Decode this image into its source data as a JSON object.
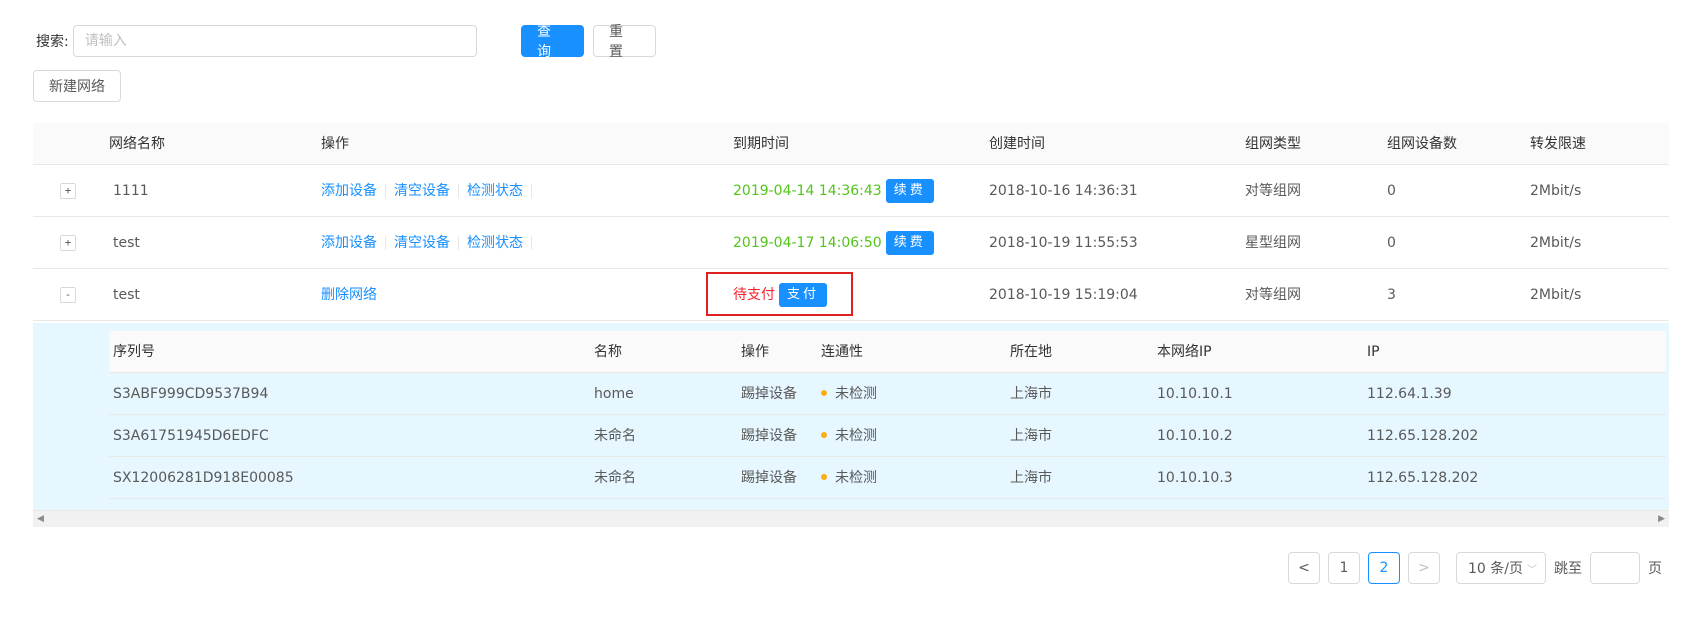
{
  "search": {
    "label": "搜索:",
    "placeholder": "请输入",
    "query_label": "查询",
    "reset_label": "重置"
  },
  "toolbar": {
    "new_network_label": "新建网络"
  },
  "table": {
    "headers": {
      "name": "网络名称",
      "ops": "操作",
      "expire": "到期时间",
      "created": "创建时间",
      "type": "组网类型",
      "device_count": "组网设备数",
      "rate": "转发限速"
    },
    "rows": [
      {
        "expand": "+",
        "name": "1111",
        "ops": [
          "添加设备",
          "清空设备",
          "检测状态"
        ],
        "expire": "2019-04-14 14:36:43",
        "expire_action": "续费",
        "created": "2018-10-16 14:36:31",
        "type": "对等组网",
        "device_count": "0",
        "rate": "2Mbit/s"
      },
      {
        "expand": "+",
        "name": "test",
        "ops": [
          "添加设备",
          "清空设备",
          "检测状态"
        ],
        "expire": "2019-04-17 14:06:50",
        "expire_action": "续费",
        "created": "2018-10-19 11:55:53",
        "type": "星型组网",
        "device_count": "0",
        "rate": "2Mbit/s"
      },
      {
        "expand": "-",
        "name": "test",
        "ops": [
          "删除网络"
        ],
        "expire": "待支付",
        "expire_action": "支付",
        "created": "2018-10-19 15:19:04",
        "type": "对等组网",
        "device_count": "3",
        "rate": "2Mbit/s"
      }
    ]
  },
  "subtable": {
    "headers": {
      "serial": "序列号",
      "name": "名称",
      "ops": "操作",
      "connectivity": "连通性",
      "location": "所在地",
      "local_ip": "本网络IP",
      "ip": "IP"
    },
    "rows": [
      {
        "serial": "S3ABF999CD9537B94",
        "name": "home",
        "op": "踢掉设备",
        "connectivity": "未检测",
        "location": "上海市",
        "local_ip": "10.10.10.1",
        "ip": "112.64.1.39"
      },
      {
        "serial": "S3A61751945D6EDFC",
        "name": "未命名",
        "op": "踢掉设备",
        "connectivity": "未检测",
        "location": "上海市",
        "local_ip": "10.10.10.2",
        "ip": "112.65.128.202"
      },
      {
        "serial": "SX12006281D918E00085",
        "name": "未命名",
        "op": "踢掉设备",
        "connectivity": "未检测",
        "location": "上海市",
        "local_ip": "10.10.10.3",
        "ip": "112.65.128.202"
      }
    ],
    "status_color": "#faad14"
  },
  "pagination": {
    "prev": "<",
    "pages": [
      "1",
      "2"
    ],
    "current": "2",
    "next": ">",
    "page_size": "10 条/页",
    "jump_label": "跳至",
    "page_label": "页"
  },
  "colors": {
    "primary": "#1890ff",
    "success": "#52c41a",
    "danger": "#f5222d",
    "highlight_border": "#e02020"
  }
}
